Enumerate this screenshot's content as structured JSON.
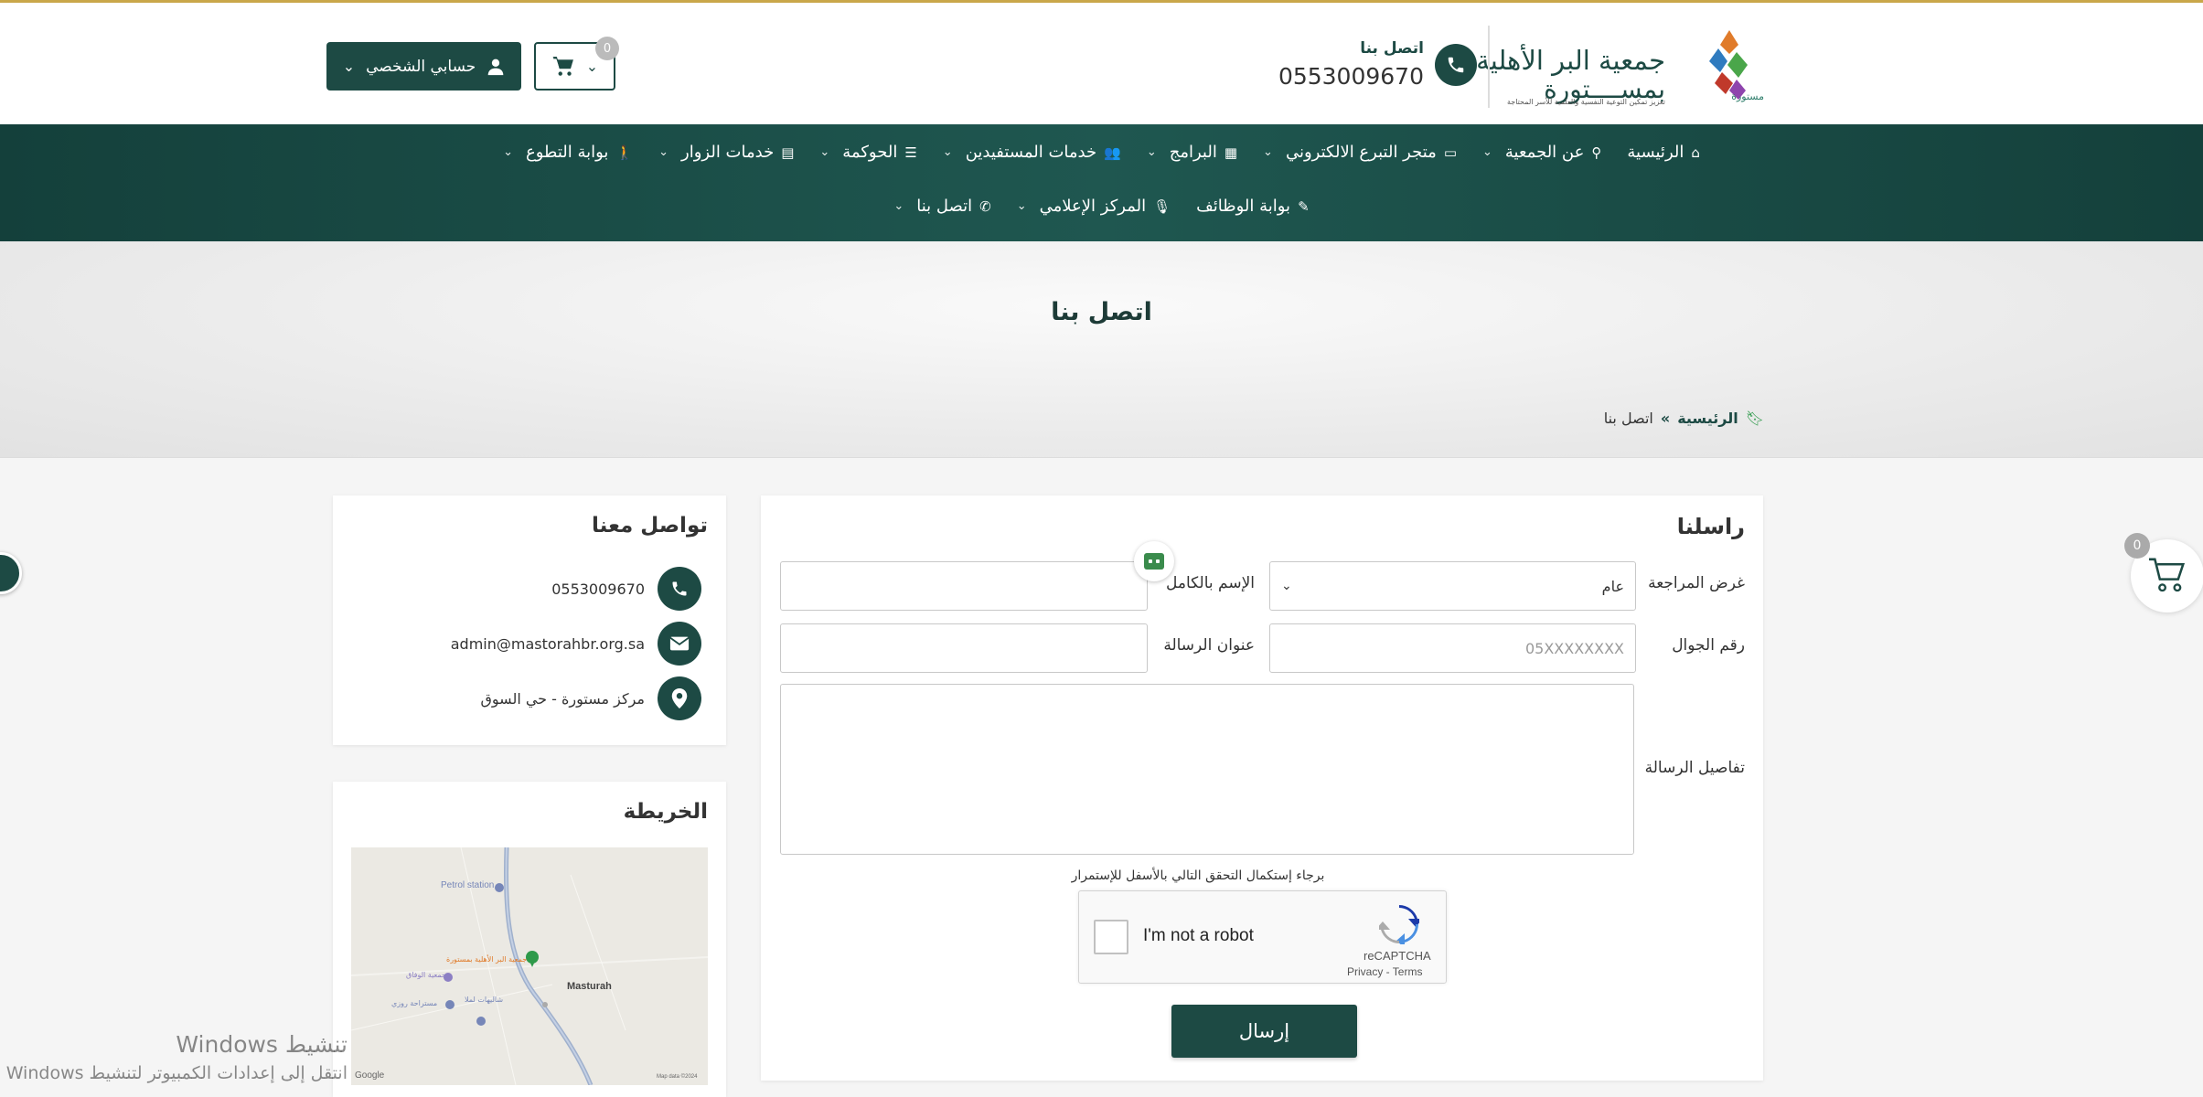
{
  "header": {
    "org_name_line1": "جمعية البر الأهلية",
    "org_name_line2": "بمســــتورة",
    "org_subtitle": "تعزيز تمكين التوعية النفسية والعلمية للأسر المحتاجة",
    "logo_caption": "مستورة",
    "contact_label": "اتصل بنا",
    "phone": "0553009670",
    "cart_count": "0",
    "account_label": "حسابي الشخصي"
  },
  "nav": {
    "row1": [
      {
        "label": "الرئيسية",
        "icon": "⌂",
        "has_dropdown": false
      },
      {
        "label": "عن الجمعية",
        "icon": "⚲",
        "has_dropdown": true
      },
      {
        "label": "متجر التبرع الالكتروني",
        "icon": "▭",
        "has_dropdown": true
      },
      {
        "label": "البرامج",
        "icon": "▦",
        "has_dropdown": true
      },
      {
        "label": "خدمات المستفيدين",
        "icon": "👥",
        "has_dropdown": true
      },
      {
        "label": "الحوكمة",
        "icon": "☰",
        "has_dropdown": true
      },
      {
        "label": "خدمات الزوار",
        "icon": "▤",
        "has_dropdown": true
      },
      {
        "label": "بوابة التطوع",
        "icon": "🚶",
        "has_dropdown": true
      }
    ],
    "row2": [
      {
        "label": "بوابة الوظائف",
        "icon": "✎",
        "has_dropdown": false
      },
      {
        "label": "المركز الإعلامي",
        "icon": "🎙",
        "has_dropdown": true
      },
      {
        "label": "اتصل بنا",
        "icon": "✆",
        "has_dropdown": true
      }
    ]
  },
  "banner": {
    "title": "اتصل بنا",
    "breadcrumb_home": "الرئيسية",
    "breadcrumb_sep": "»",
    "breadcrumb_current": "اتصل بنا"
  },
  "form": {
    "title": "راسلنا",
    "purpose_label": "غرض المراجعة",
    "purpose_value": "عام",
    "fullname_label": "الإسم بالكامل",
    "fullname_value": "",
    "mobile_label": "رقم الجوال",
    "mobile_placeholder": "05XXXXXXXX",
    "subject_label": "عنوان الرسالة",
    "subject_value": "",
    "details_label": "تفاصيل الرسالة",
    "captcha_note": "برجاء إستكمال التحقق التالي بالأسفل للإستمرار",
    "captcha_text": "I'm not a robot",
    "captcha_brand": "reCAPTCHA",
    "captcha_links": "Privacy - Terms",
    "submit_label": "إرسال"
  },
  "contact": {
    "title": "تواصل معنا",
    "phone": "0553009670",
    "email": "admin@mastorahbr.org.sa",
    "address": "مركز مستورة - حي السوق"
  },
  "map": {
    "title": "الخريطة",
    "labels": {
      "petrol": "Petrol station",
      "town": "Masturah",
      "place1": "جمعية البر الأهلية بمستورة",
      "place2": "جمعية الوفاق",
      "place3": "مستراحة روزي",
      "place4": "شاليهات لملا",
      "google": "Google",
      "mapdata": "Map data ©2024"
    }
  },
  "side": {
    "cart_count": "0"
  },
  "watermark": {
    "line1": "تنشيط Windows",
    "line2": "انتقل إلى إعدادات الكمبيوتر لتنشيط Windows"
  },
  "colors": {
    "brand": "#1d4a44",
    "accent_green": "#2e9a4a",
    "gold": "#c9a74a"
  }
}
